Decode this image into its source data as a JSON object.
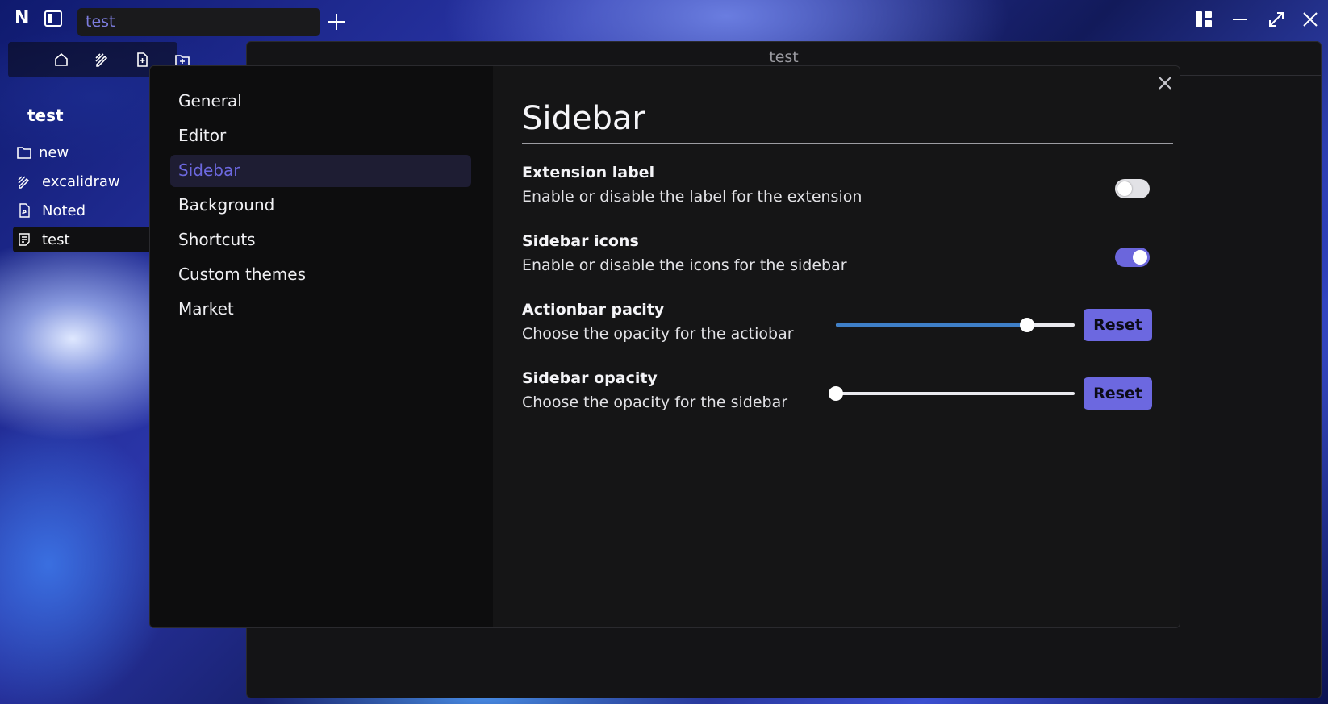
{
  "topbar": {
    "logo": "N",
    "tab_label": "test"
  },
  "main_window": {
    "title": "test"
  },
  "sidebar": {
    "root_title": "test",
    "items": [
      {
        "label": "new",
        "icon": "folder-icon"
      },
      {
        "label": "excalidraw",
        "icon": "draw-icon"
      },
      {
        "label": "Noted",
        "icon": "pdf-file-icon"
      },
      {
        "label": "test",
        "icon": "note-file-icon"
      }
    ]
  },
  "settings": {
    "nav": [
      {
        "label": "General"
      },
      {
        "label": "Editor"
      },
      {
        "label": "Sidebar"
      },
      {
        "label": "Background"
      },
      {
        "label": "Shortcuts"
      },
      {
        "label": "Custom themes"
      },
      {
        "label": "Market"
      }
    ],
    "selected_nav": "Sidebar",
    "heading": "Sidebar",
    "options": [
      {
        "title": "Extension label",
        "description": "Enable or disable the label for the extension",
        "type": "toggle",
        "enabled": false
      },
      {
        "title": "Sidebar icons",
        "description": "Enable or disable the icons for the sidebar",
        "type": "toggle",
        "enabled": true
      },
      {
        "title": "Actionbar pacity",
        "description": "Choose the opacity for the actiobar",
        "type": "slider",
        "value": 0.8,
        "button": "Reset"
      },
      {
        "title": "Sidebar opacity",
        "description": "Choose the opacity for the sidebar",
        "type": "slider",
        "value": 0.0,
        "button": "Reset"
      }
    ]
  },
  "colors": {
    "accent": "#6c68e0",
    "slider_fill": "#3e7fc8",
    "modal_bg": "#151516",
    "nav_bg": "#0d0d0e"
  }
}
